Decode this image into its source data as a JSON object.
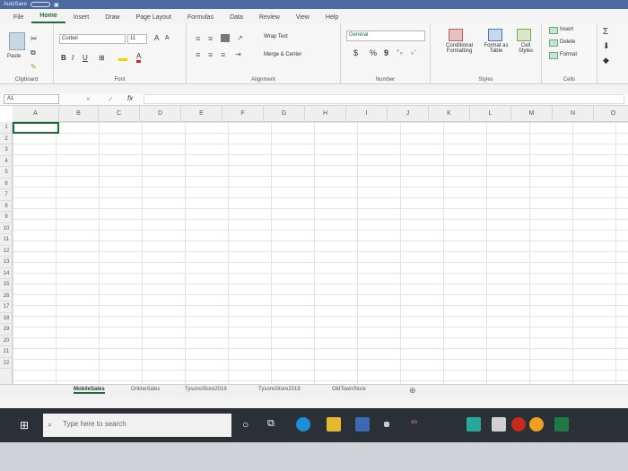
{
  "titlebar": {
    "autosave": "AutoSave"
  },
  "tabs": [
    "File",
    "Home",
    "Insert",
    "Draw",
    "Page Layout",
    "Formulas",
    "Data",
    "Review",
    "View",
    "Help"
  ],
  "ribbon": {
    "clipboard": {
      "paste": "Paste",
      "label": "Clipboard"
    },
    "font": {
      "name": "Corbel",
      "size": "11",
      "bold": "B",
      "italic": "I",
      "underline": "U",
      "grow": "A",
      "shrink": "A",
      "label": "Font"
    },
    "alignment": {
      "wrap": "Wrap Text",
      "merge": "Merge & Center",
      "label": "Alignment"
    },
    "number": {
      "format": "General",
      "currency": "$",
      "percent": "%",
      "comma": "9",
      "label": "Number"
    },
    "styles": {
      "conditional": "Conditional Formatting",
      "table": "Format as Table",
      "cell": "Cell Styles",
      "label": "Styles"
    },
    "cells": {
      "insert": "Insert",
      "delete": "Delete",
      "format": "Format",
      "label": "Cells"
    }
  },
  "formula_bar": {
    "namebox": "A1",
    "fx": "fx",
    "cancel": "×",
    "enter": "✓"
  },
  "columns": [
    "A",
    "B",
    "C",
    "D",
    "E",
    "F",
    "G",
    "H",
    "I",
    "J",
    "K",
    "L",
    "M",
    "N",
    "O"
  ],
  "rows": [
    "1",
    "2",
    "3",
    "4",
    "5",
    "6",
    "7",
    "8",
    "9",
    "10",
    "11",
    "12",
    "13",
    "14",
    "15",
    "16",
    "17",
    "18",
    "19",
    "20",
    "21",
    "22"
  ],
  "sheets": [
    "MobileSales",
    "OnlineSales",
    "TysonsStore2019",
    "TysonsStore2018",
    "OldTownStore"
  ],
  "taskbar": {
    "search_placeholder": "Type here to search"
  }
}
